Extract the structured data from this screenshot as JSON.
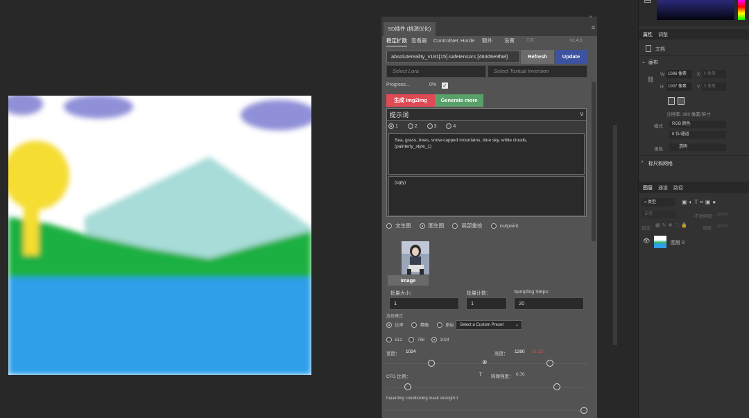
{
  "colors": {
    "app_background": "#282828",
    "panel_background": "#535353",
    "refresh_button": "#6c6c6c",
    "update_button": "#3d52a0",
    "generate_button": "#e04a55",
    "generate_more_button": "#5aa06a",
    "sky": "#ffffff",
    "cloud": "#9090d8",
    "sun_tree": "#f5dd30",
    "mountain": "#a8dcd8",
    "grass": "#1fb043",
    "sea": "#2f9fe8"
  },
  "plugin": {
    "tab_title": "SD插件 (桃源仪化)",
    "menu_icon": "hamburger-menu",
    "tabs": [
      "稳定扩散",
      "查看器",
      "ControlNet",
      "Horde",
      "额外",
      "设置",
      "工具"
    ],
    "version": "v1.4.1",
    "model_value": "absolutereality_v181[15].safetensors [463d6e9fa8]",
    "refresh_label": "Refresh",
    "update_label": "Update",
    "lora_placeholder": "Select Lora",
    "ti_placeholder": "Select Textual Inversion",
    "progress_label": "Progress...",
    "progress_value": "0%",
    "progress_fraction": 0,
    "generate_label": "生成 Img2Img",
    "generate_more_label": "Generate more",
    "prompt_header": "提示词",
    "prompt_collapse": "v",
    "prompt_tabs": [
      "1",
      "2",
      "3",
      "4"
    ],
    "prompt_text": "Sea, grass, trees, snow-capped mountains, blue sky, white clouds,\n(painterly_style_1)",
    "negative_text": "(ugly)",
    "modes": [
      "文生图",
      "图生图",
      "局部重绘",
      "outpaint"
    ],
    "image_button": "Image",
    "batch_size_label": "批量大小：",
    "batch_size_value": "1",
    "batch_count_label": "批量计数：",
    "batch_count_value": "1",
    "steps_label": "Sampling Steps:",
    "steps_value": "20",
    "select_mode_label": "选择模式",
    "select_modes": [
      "比率",
      "精确",
      "原始"
    ],
    "preset_value": "Select a Custom Preset",
    "sizes": [
      "512",
      "768",
      "1024"
    ],
    "width_label": "宽度：",
    "width_value": "1024",
    "height_label": "高度：",
    "height_value": "1260",
    "height_extra": "x1.23",
    "cfg_label": "CFG 比例：",
    "cfg_value": "7",
    "denoise_label": "降噪强度：",
    "denoise_value": "0.70",
    "mask_strength_label": "Inpainting conditioning mask strength:1"
  },
  "right_panel": {
    "tabs": [
      "属性",
      "调整"
    ],
    "doc_label": "文档",
    "canvas_section": "画布",
    "w_label": "W",
    "w_value": "1086 像素",
    "x_label": "X",
    "x_placeholder": "0 像素",
    "h_label": "H",
    "h_value": "1007 像素",
    "y_label": "Y",
    "y_placeholder": "0 像素",
    "resolution": "分辨率: 300 像素/英寸",
    "mode_label": "模式",
    "mode_value": "RGB 颜色",
    "bit_value": "8 位/通道",
    "fill_label": "填色",
    "fill_value": "透明",
    "rulers_section": "标尺和网格",
    "layer_tabs": [
      "图层",
      "通道",
      "路径"
    ],
    "kind_label": "类型",
    "blend_mode": "正常",
    "opacity_label": "不透明度:",
    "opacity_value": "100%",
    "lock_label": "锁定:",
    "fill_label2": "填充:",
    "fill_value2": "100%",
    "layer_name": "图层 0"
  }
}
